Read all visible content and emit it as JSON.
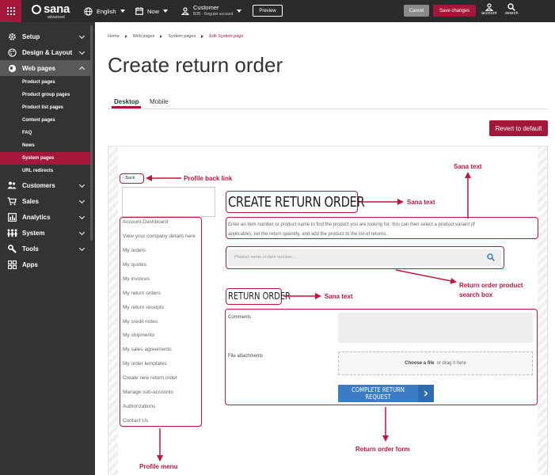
{
  "topbar": {
    "logo": "sana",
    "logo_sub": "advanced",
    "language": "English",
    "date": "Now",
    "customer_name": "Customer",
    "customer_account": "B2B - Regular account",
    "preview_label": "Preview",
    "cancel_label": "Cancel",
    "save_label": "Save changes",
    "account_label": "account",
    "search_label": "search"
  },
  "sidebar": {
    "items": [
      {
        "label": "Setup",
        "icon": "gear-icon"
      },
      {
        "label": "Design & Layout",
        "icon": "palette-icon"
      },
      {
        "label": "Web pages",
        "icon": "globe-icon"
      },
      {
        "label": "Customers",
        "icon": "people-icon"
      },
      {
        "label": "Sales",
        "icon": "cart-icon"
      },
      {
        "label": "Analytics",
        "icon": "chart-icon"
      },
      {
        "label": "System",
        "icon": "network-icon"
      },
      {
        "label": "Tools",
        "icon": "wrench-icon"
      },
      {
        "label": "Apps",
        "icon": "apps-icon"
      }
    ],
    "sub_items": [
      "Product pages",
      "Product group pages",
      "Product list pages",
      "Content pages",
      "FAQ",
      "News",
      "System pages",
      "URL redirects"
    ]
  },
  "breadcrumb": [
    "Home",
    "Web pages",
    "System pages",
    "Edit System page"
  ],
  "page_title": "Create return order",
  "tabs": [
    "Desktop",
    "Mobile"
  ],
  "revert_label": "Revert to default",
  "preview": {
    "back_label": "Back",
    "profile_menu": [
      "Account Dashboard",
      "View your company details here",
      "My orders",
      "My quotes",
      "My invoices",
      "My return orders",
      "My return receipts",
      "My credit notes",
      "My shipments",
      "My sales agreements",
      "My order templates",
      "Create new return order",
      "Manage sub-accounts",
      "Authorizations",
      "Contact Us"
    ],
    "heading": "CREATE RETURN ORDER",
    "intro_line1": "Enter an item number or product name to find the product you are looking for. You can then select a product variant (if",
    "intro_line2": "applicable), set the return quantity, and add the product to the list of returns.",
    "search_placeholder": "Product name or item number...",
    "return_heading": "RETURN ORDER",
    "comments_label": "Comments",
    "attachments_label": "File attachments",
    "choose_file": "Choose a file",
    "drag_text": "or drag it here",
    "submit_label": "COMPLETE RETURN REQUEST"
  },
  "annotations": {
    "profile_back_link": "Profile back link",
    "sana_text_top": "Sana text",
    "sana_text_heading": "Sana text",
    "search_box_line1": "Return order product",
    "search_box_line2": "search box",
    "sana_text_return": "Sana text",
    "profile_menu": "Profile menu",
    "return_order_form": "Return order form"
  },
  "colors": {
    "brand": "#a4173a",
    "annotation": "#c0163c",
    "submit": "#3b7dc4"
  }
}
